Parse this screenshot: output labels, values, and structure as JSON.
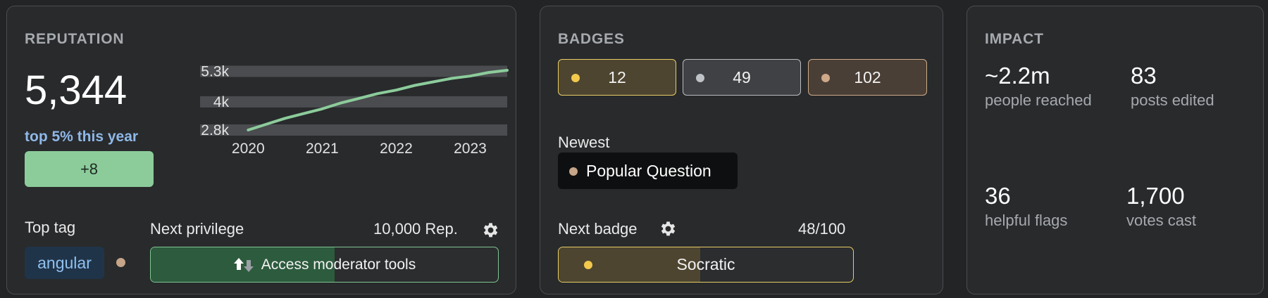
{
  "reputation": {
    "title": "REPUTATION",
    "value": "5,344",
    "rank": "top 5% this year",
    "change": "+8",
    "chart_data": {
      "type": "line",
      "x": [
        2020.0,
        2020.25,
        2020.5,
        2020.75,
        2021.0,
        2021.25,
        2021.5,
        2021.75,
        2022.0,
        2022.25,
        2022.5,
        2022.75,
        2023.0,
        2023.25,
        2023.5
      ],
      "values": [
        2800,
        3050,
        3300,
        3500,
        3700,
        3950,
        4150,
        4350,
        4500,
        4700,
        4850,
        5000,
        5100,
        5250,
        5344
      ],
      "y_ticks": [
        {
          "value": 2800,
          "label": "2.8k"
        },
        {
          "value": 4000,
          "label": "4k"
        },
        {
          "value": 5300,
          "label": "5.3k"
        }
      ],
      "x_ticks": [
        {
          "value": 2020,
          "label": "2020"
        },
        {
          "value": 2021,
          "label": "2021"
        },
        {
          "value": 2022,
          "label": "2022"
        },
        {
          "value": 2023,
          "label": "2023"
        }
      ],
      "xlim": [
        2019.75,
        2023.5
      ],
      "ylim": [
        2800,
        5344
      ],
      "line_color": "#8ccc9b",
      "band_color": "#4a4c4f"
    },
    "top_tag_label": "Top tag",
    "top_tag": "angular",
    "next_privilege_label": "Next privilege",
    "next_privilege_rep": "10,000 Rep.",
    "next_privilege_name": "Access moderator tools",
    "next_privilege_progress": 0.53
  },
  "badges": {
    "title": "BADGES",
    "gold": "12",
    "silver": "49",
    "bronze": "102",
    "newest_label": "Newest",
    "newest_badge": "Popular Question",
    "next_badge_label": "Next badge",
    "next_badge_progress_text": "48/100",
    "next_badge_name": "Socratic",
    "next_badge_progress": 0.48
  },
  "impact": {
    "title": "IMPACT",
    "people_reached": "~2.2m",
    "people_reached_label": "people reached",
    "posts_edited": "83",
    "posts_edited_label": "posts edited",
    "helpful_flags": "36",
    "helpful_flags_label": "helpful flags",
    "votes_cast": "1,700",
    "votes_cast_label": "votes cast"
  },
  "colors": {
    "accent_green": "#8ccc9b",
    "accent_blue": "#8fb8e8",
    "gold": "#f2c94c",
    "silver": "#bfc2c6",
    "bronze": "#cda98a"
  }
}
